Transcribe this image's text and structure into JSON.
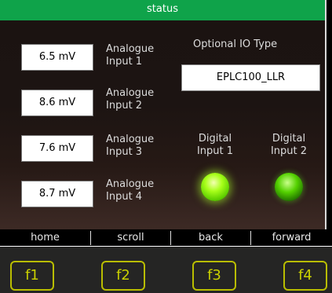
{
  "header": {
    "title": "status"
  },
  "analogue_inputs": [
    {
      "value": "6.5 mV",
      "label_line1": "Analogue",
      "label_line2": "Input 1"
    },
    {
      "value": "8.6 mV",
      "label_line1": "Analogue",
      "label_line2": "Input 2"
    },
    {
      "value": "7.6 mV",
      "label_line1": "Analogue",
      "label_line2": "Input 3"
    },
    {
      "value": "8.7 mV",
      "label_line1": "Analogue",
      "label_line2": "Input 4"
    }
  ],
  "optional_io": {
    "title": "Optional IO Type",
    "value": "EPLC100_LLR"
  },
  "digital_inputs": [
    {
      "label_line1": "Digital",
      "label_line2": "Input 1",
      "state": "on",
      "color": "#a8ff1a"
    },
    {
      "label_line1": "Digital",
      "label_line2": "Input 2",
      "state": "on",
      "color": "#54d100"
    }
  ],
  "softkeys": [
    "home",
    "scroll",
    "back",
    "forward"
  ],
  "function_keys": [
    "f1",
    "f2",
    "f3",
    "f4"
  ],
  "colors": {
    "header": "#0fa34a",
    "function_key": "#b9bd00"
  }
}
